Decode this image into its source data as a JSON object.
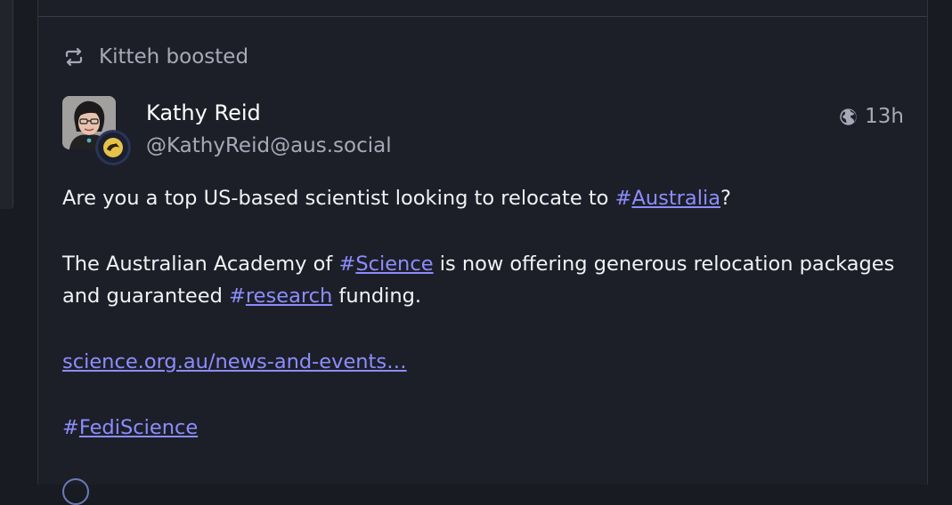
{
  "boost": {
    "icon": "repeat-icon",
    "text": "Kitteh boosted"
  },
  "author": {
    "display_name": "Kathy Reid",
    "handle": "@KathyReid@aus.social"
  },
  "meta": {
    "visibility_icon": "globe-icon",
    "time": "13h"
  },
  "content": {
    "line1_text": "Are you a top US-based scientist looking to relocate to ",
    "tag_australia": "Australia",
    "line1_end": "?",
    "line2_text": "The Australian Academy of ",
    "tag_science": "Science",
    "line2_mid": " is now offering generous relocation packages and guaranteed ",
    "tag_research": "research",
    "line2_end": " funding.",
    "link": "science.org.au/news-and-events…",
    "tag_fediscience": "FediScience",
    "hash": "#"
  },
  "colors": {
    "background": "#191b22",
    "column": "#1d1f28",
    "link": "#8c8dff",
    "muted": "#a7a9b8"
  }
}
